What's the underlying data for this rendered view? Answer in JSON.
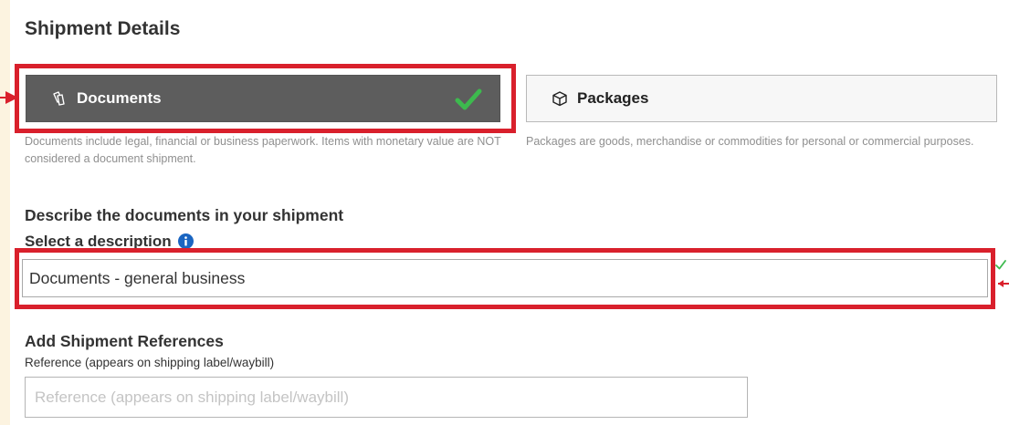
{
  "section": {
    "title": "Shipment Details"
  },
  "shipment_types": {
    "documents": {
      "label": "Documents",
      "icon": "documents-icon",
      "selected": true,
      "description": "Documents include legal, financial or business paperwork. Items with monetary value are NOT considered a document shipment."
    },
    "packages": {
      "label": "Packages",
      "icon": "package-box-icon",
      "selected": false,
      "description": "Packages are goods, merchandise or commodities for personal or commercial purposes."
    }
  },
  "describe": {
    "heading": "Describe the documents in your shipment",
    "select_label": "Select a description",
    "selected_value": "Documents - general business"
  },
  "references": {
    "heading": "Add Shipment References",
    "field_label": "Reference (appears on shipping label/waybill)",
    "placeholder": "Reference (appears on shipping label/waybill)"
  },
  "colors": {
    "page_background": "#fcf3e0",
    "selected_button": "#5d5d5d",
    "check_green": "#3dba4e",
    "info_blue": "#1a65c1",
    "annotation_red": "#d9202c"
  }
}
